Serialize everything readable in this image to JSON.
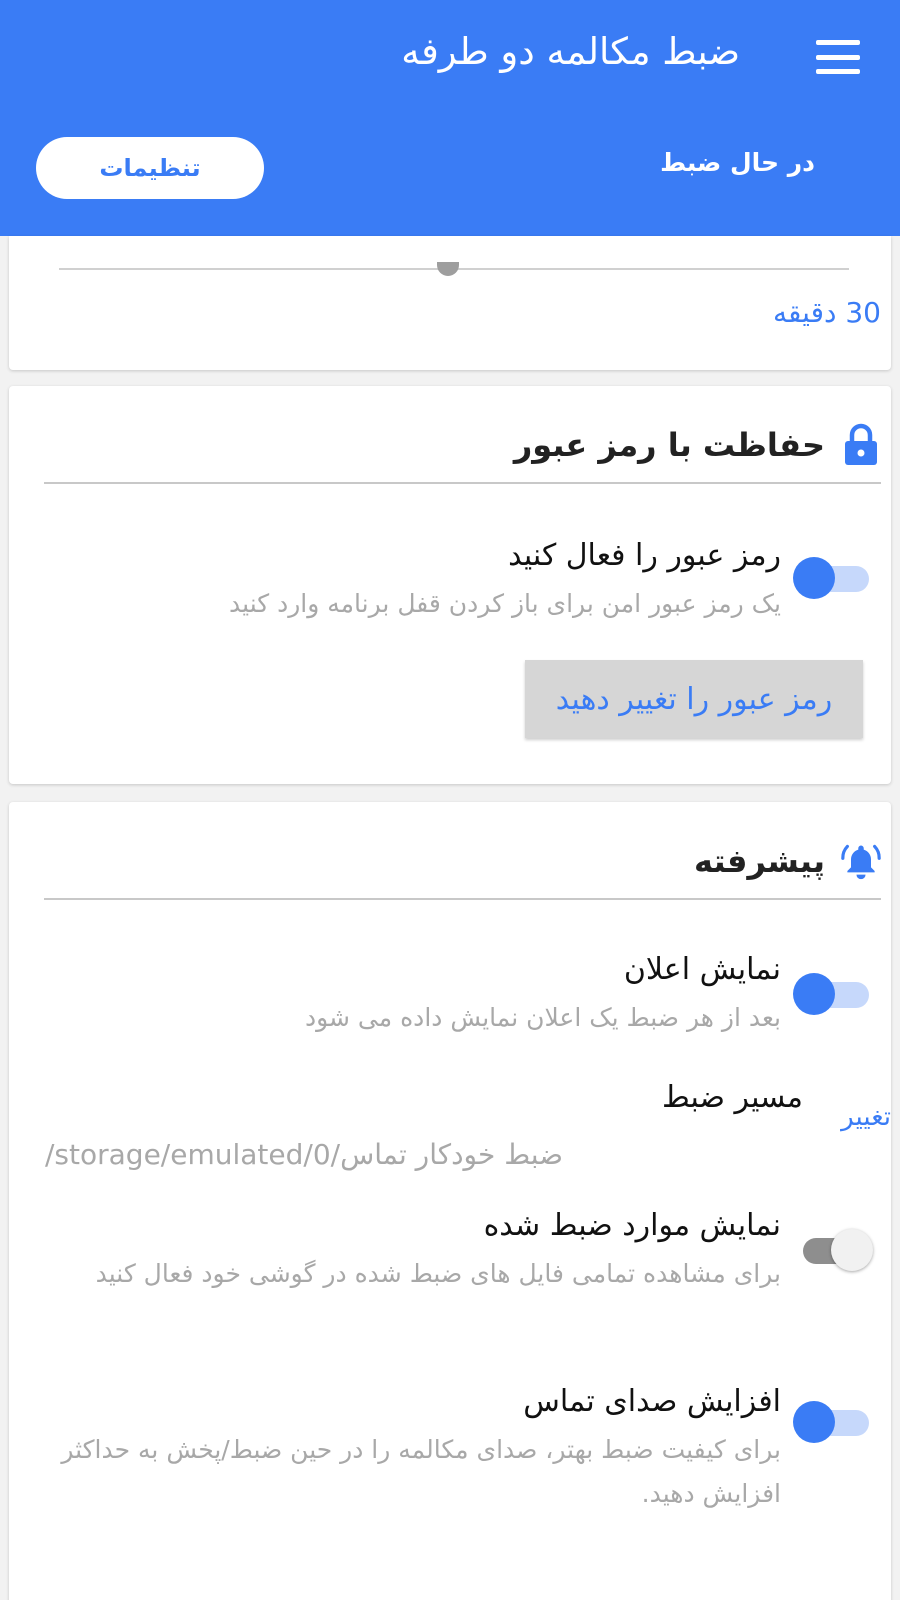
{
  "app_bar": {
    "title": "ضبط مکالمه دو طرفه",
    "menu_icon": "hamburger-menu-icon",
    "tabs": [
      {
        "label": "در حال ضبط",
        "selected": false
      },
      {
        "label": "تنظیمات",
        "selected": true
      }
    ]
  },
  "duration_card": {
    "value_label": "30 دقیقه"
  },
  "password_section": {
    "icon": "lock-icon",
    "title": "حفاظت با رمز عبور",
    "enable_password": {
      "title": "رمز عبور را فعال کنید",
      "subtitle": "یک رمز عبور امن برای باز کردن قفل برنامه وارد کنید",
      "enabled": true
    },
    "change_password_button": "رمز عبور را تغییر دهید"
  },
  "advanced_section": {
    "icon": "bell-ringing-icon",
    "title": "پیشرفته",
    "show_notification": {
      "title": "نمایش اعلان",
      "subtitle": "بعد از هر ضبط یک اعلان نمایش داده می شود",
      "enabled": true
    },
    "recording_path": {
      "title": "مسیر ضبط",
      "change_label": "تغییر",
      "path": "/storage/emulated/0/ضبط خودکار تماس"
    },
    "show_recorded": {
      "title": "نمایش موارد ضبط شده",
      "subtitle": "برای مشاهده تمامی فایل های ضبط شده در گوشی خود فعال کنید",
      "enabled": false
    },
    "boost_volume": {
      "title": "افزایش صدای تماس",
      "subtitle": "برای کیفیت ضبط بهتر، صدای مکالمه را در حین ضبط/پخش به حداکثر افزایش دهید.",
      "enabled": true
    }
  },
  "colors": {
    "primary": "#3a7cf5",
    "toggle_track_on": "#c6d8fb",
    "secondary_text": "#a8a8a8"
  }
}
